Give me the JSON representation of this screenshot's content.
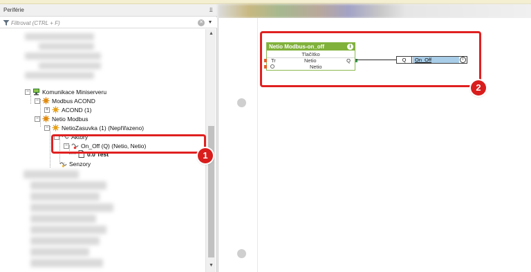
{
  "panel": {
    "title": "Periférie",
    "pin_icon": "pin-icon"
  },
  "filter": {
    "placeholder": "Filtrovat (CTRL + F)",
    "value": ""
  },
  "tree": {
    "items": [
      {
        "label": "Komunikace Miniserveru",
        "icon": "network-icon",
        "bold": false
      },
      {
        "label": "Modbus ACOND",
        "icon": "modbus-icon",
        "bold": false
      },
      {
        "label": "ACOND (1)",
        "icon": "device-icon",
        "bold": false
      },
      {
        "label": "Netio Modbus",
        "icon": "modbus-icon",
        "bold": false
      },
      {
        "label": "NetioZasuvka (1) (Nepřiřazeno)",
        "icon": "device-icon",
        "bold": false
      },
      {
        "label": "Aktory",
        "icon": "actuators-icon",
        "bold": false
      },
      {
        "label": "On_Off (Q) (Netio, Netio)",
        "icon": "output-icon",
        "bold": false
      },
      {
        "label": "0.0 Test",
        "icon": "document-icon",
        "bold": true
      },
      {
        "label": "Senzory",
        "icon": "sensors-icon",
        "bold": false
      }
    ]
  },
  "function_block": {
    "title": "Netio Modbus-on_off",
    "type": "Tlačítko",
    "input_tr": "Tr",
    "input_tr_name": "Netio",
    "output_q": "Q",
    "input_2_name": "Netio"
  },
  "output_connector": {
    "pin": "Q",
    "name": "On_Off",
    "info": "i"
  },
  "badges": {
    "one": "1",
    "two": "2"
  },
  "colors": {
    "block_header": "#80b13a",
    "highlight": "#e02020",
    "connector_name_bg": "#a8cde8"
  }
}
